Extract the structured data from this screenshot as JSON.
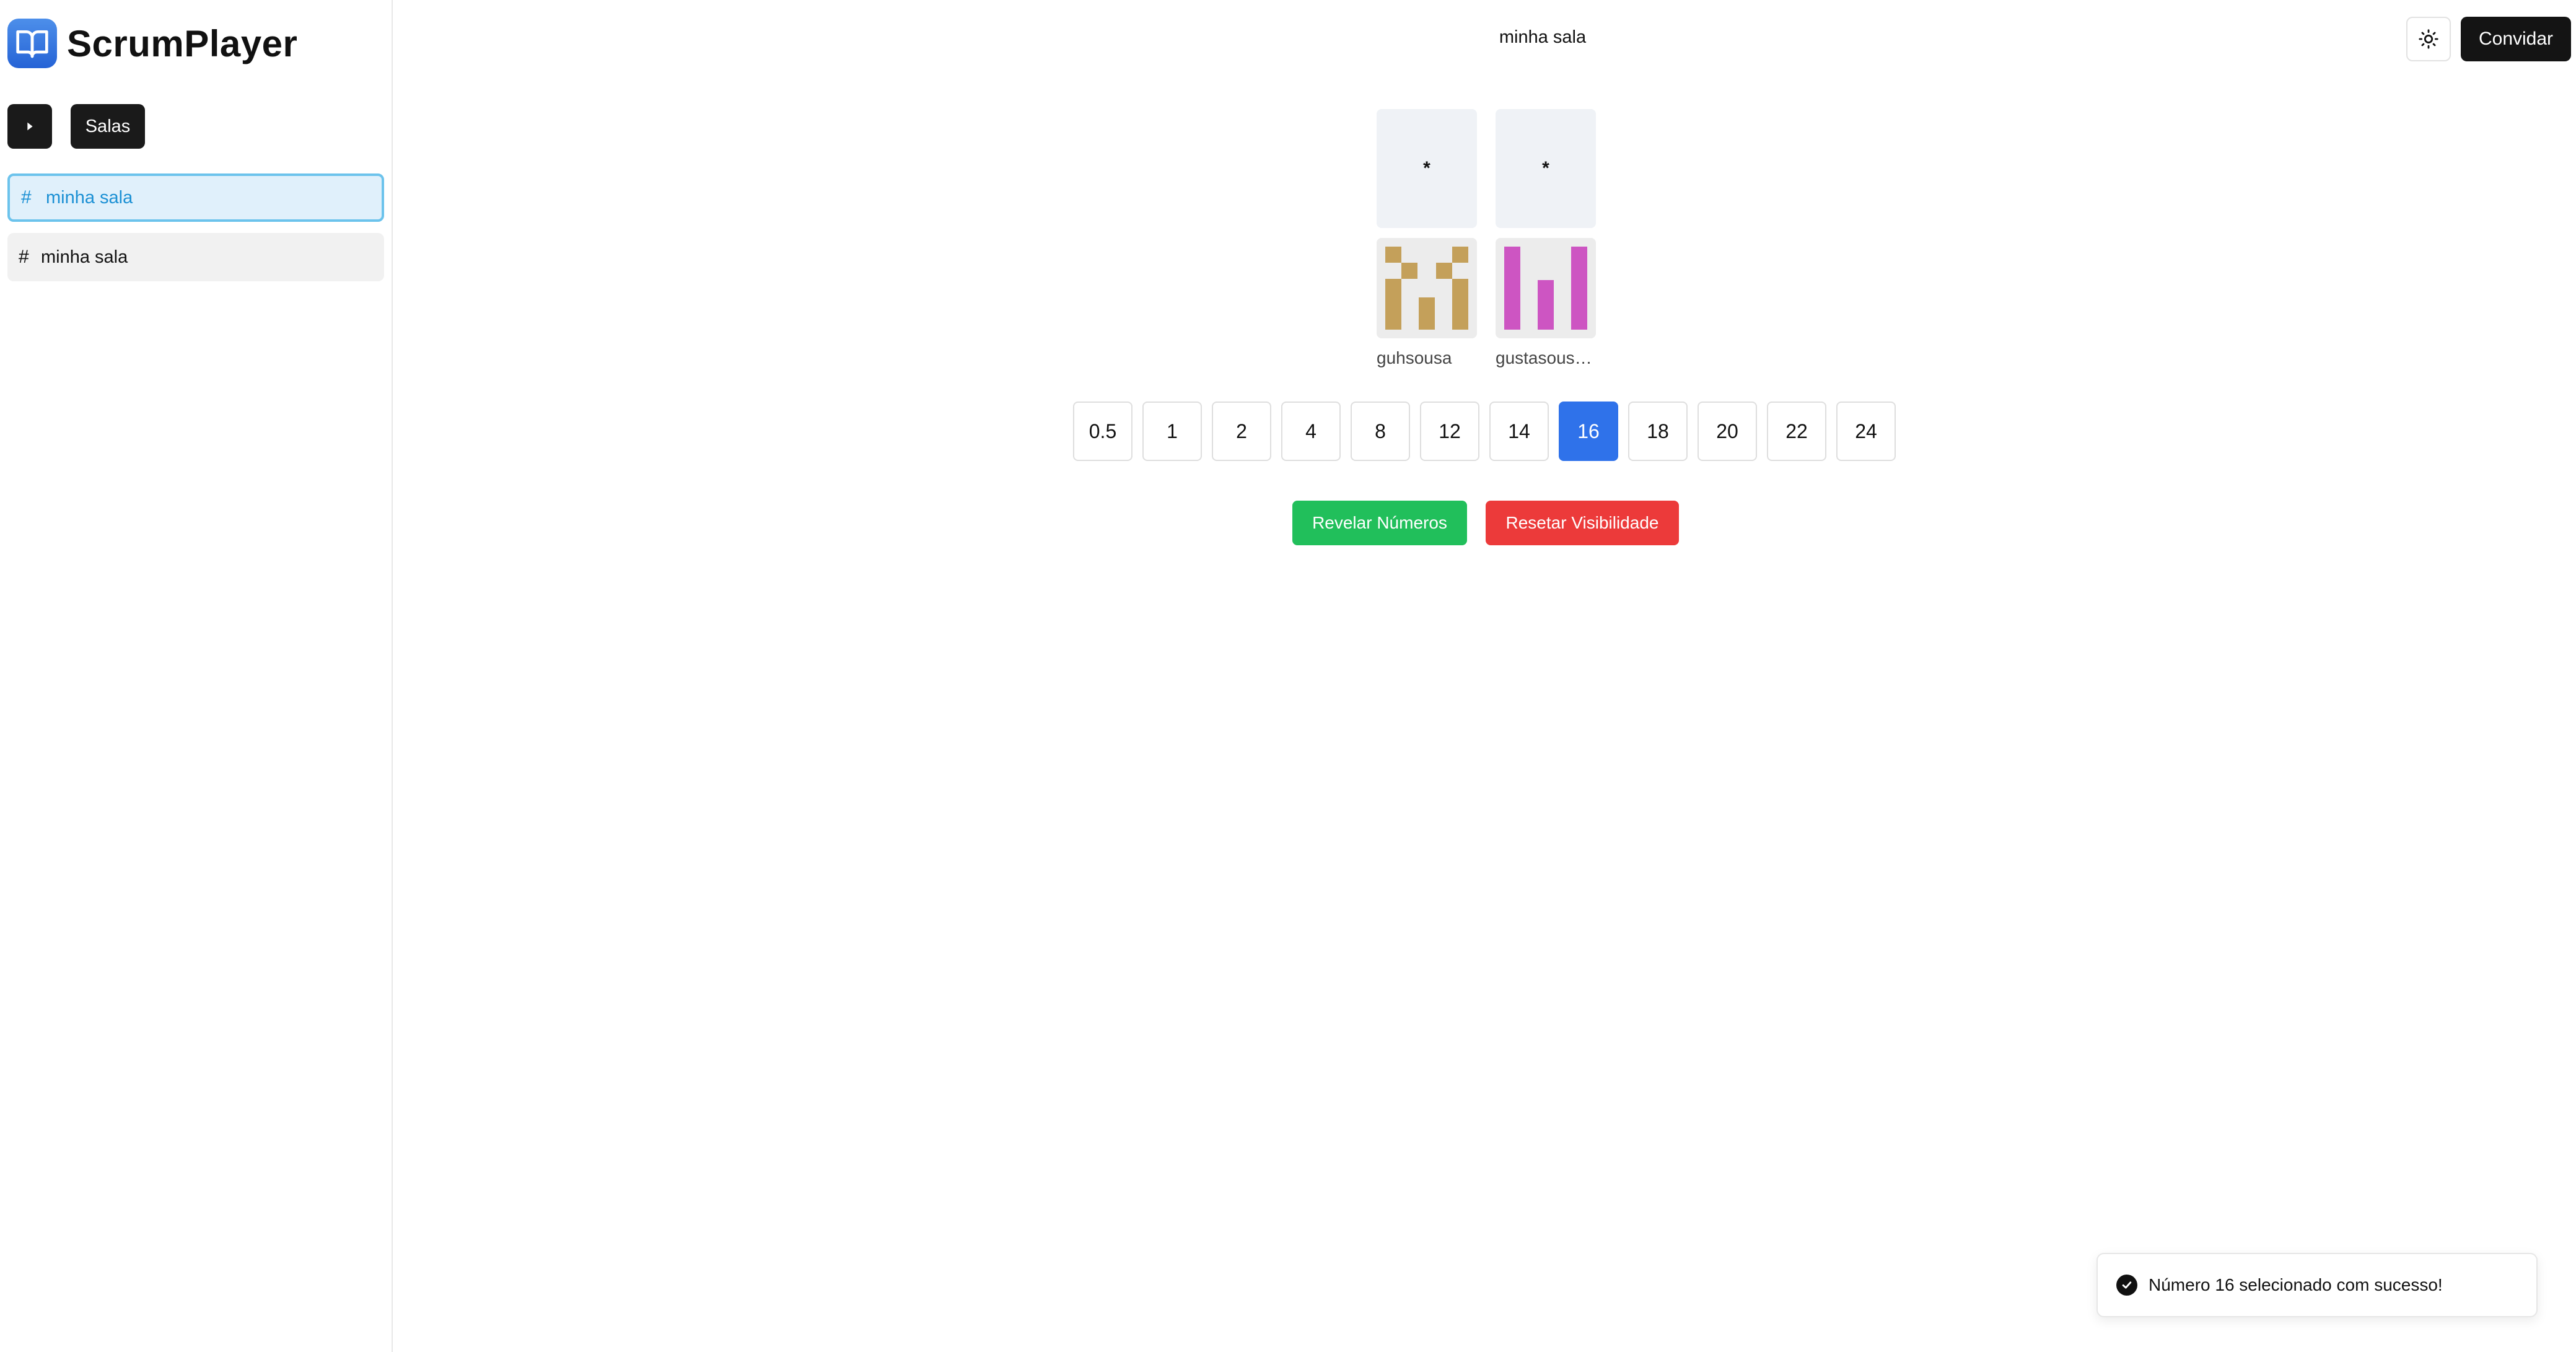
{
  "brand": {
    "name": "ScrumPlayer"
  },
  "sidebar": {
    "salas_label": "Salas",
    "rooms": [
      {
        "hash": "#",
        "label": "minha sala"
      },
      {
        "hash": "#",
        "label": "minha sala"
      }
    ]
  },
  "header": {
    "room_title": "minha sala",
    "invite_label": "Convidar"
  },
  "players": [
    {
      "card_value": "*",
      "name": "guhsousa",
      "avatar_color": "#c4a05a"
    },
    {
      "card_value": "*",
      "name": "gustasous…",
      "avatar_color": "#cd55c2"
    }
  ],
  "deck": {
    "values": [
      "0.5",
      "1",
      "2",
      "4",
      "8",
      "12",
      "14",
      "16",
      "18",
      "20",
      "22",
      "24"
    ],
    "selected": "16"
  },
  "actions": {
    "reveal_label": "Revelar Números",
    "reset_label": "Resetar Visibilidade"
  },
  "toast": {
    "message": "Número 16 selecionado com sucesso!"
  },
  "colors": {
    "accent_blue": "#2f72ea",
    "success_green": "#21bf5b",
    "danger_red": "#ec3a3a",
    "active_room_text": "#1b90d4"
  }
}
